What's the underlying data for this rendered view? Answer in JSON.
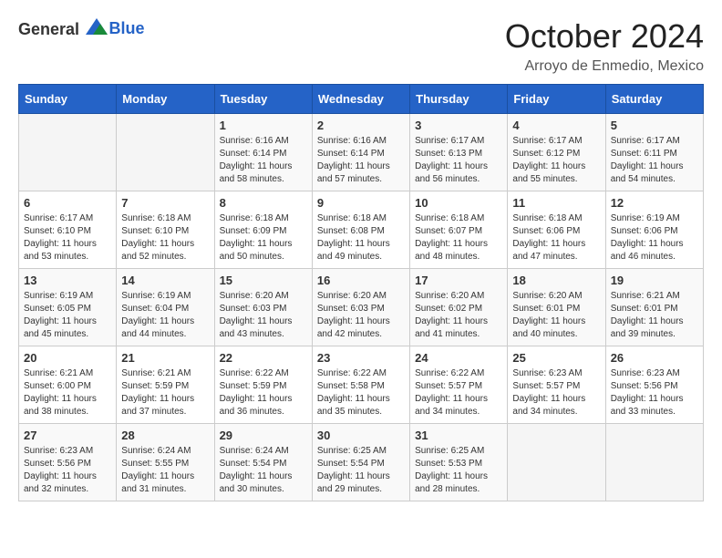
{
  "header": {
    "logo": {
      "general": "General",
      "blue": "Blue"
    },
    "title": "October 2024",
    "location": "Arroyo de Enmedio, Mexico"
  },
  "weekdays": [
    "Sunday",
    "Monday",
    "Tuesday",
    "Wednesday",
    "Thursday",
    "Friday",
    "Saturday"
  ],
  "weeks": [
    [
      {
        "day": "",
        "sunrise": "",
        "sunset": "",
        "daylight": ""
      },
      {
        "day": "",
        "sunrise": "",
        "sunset": "",
        "daylight": ""
      },
      {
        "day": "1",
        "sunrise": "Sunrise: 6:16 AM",
        "sunset": "Sunset: 6:14 PM",
        "daylight": "Daylight: 11 hours and 58 minutes."
      },
      {
        "day": "2",
        "sunrise": "Sunrise: 6:16 AM",
        "sunset": "Sunset: 6:14 PM",
        "daylight": "Daylight: 11 hours and 57 minutes."
      },
      {
        "day": "3",
        "sunrise": "Sunrise: 6:17 AM",
        "sunset": "Sunset: 6:13 PM",
        "daylight": "Daylight: 11 hours and 56 minutes."
      },
      {
        "day": "4",
        "sunrise": "Sunrise: 6:17 AM",
        "sunset": "Sunset: 6:12 PM",
        "daylight": "Daylight: 11 hours and 55 minutes."
      },
      {
        "day": "5",
        "sunrise": "Sunrise: 6:17 AM",
        "sunset": "Sunset: 6:11 PM",
        "daylight": "Daylight: 11 hours and 54 minutes."
      }
    ],
    [
      {
        "day": "6",
        "sunrise": "Sunrise: 6:17 AM",
        "sunset": "Sunset: 6:10 PM",
        "daylight": "Daylight: 11 hours and 53 minutes."
      },
      {
        "day": "7",
        "sunrise": "Sunrise: 6:18 AM",
        "sunset": "Sunset: 6:10 PM",
        "daylight": "Daylight: 11 hours and 52 minutes."
      },
      {
        "day": "8",
        "sunrise": "Sunrise: 6:18 AM",
        "sunset": "Sunset: 6:09 PM",
        "daylight": "Daylight: 11 hours and 50 minutes."
      },
      {
        "day": "9",
        "sunrise": "Sunrise: 6:18 AM",
        "sunset": "Sunset: 6:08 PM",
        "daylight": "Daylight: 11 hours and 49 minutes."
      },
      {
        "day": "10",
        "sunrise": "Sunrise: 6:18 AM",
        "sunset": "Sunset: 6:07 PM",
        "daylight": "Daylight: 11 hours and 48 minutes."
      },
      {
        "day": "11",
        "sunrise": "Sunrise: 6:18 AM",
        "sunset": "Sunset: 6:06 PM",
        "daylight": "Daylight: 11 hours and 47 minutes."
      },
      {
        "day": "12",
        "sunrise": "Sunrise: 6:19 AM",
        "sunset": "Sunset: 6:06 PM",
        "daylight": "Daylight: 11 hours and 46 minutes."
      }
    ],
    [
      {
        "day": "13",
        "sunrise": "Sunrise: 6:19 AM",
        "sunset": "Sunset: 6:05 PM",
        "daylight": "Daylight: 11 hours and 45 minutes."
      },
      {
        "day": "14",
        "sunrise": "Sunrise: 6:19 AM",
        "sunset": "Sunset: 6:04 PM",
        "daylight": "Daylight: 11 hours and 44 minutes."
      },
      {
        "day": "15",
        "sunrise": "Sunrise: 6:20 AM",
        "sunset": "Sunset: 6:03 PM",
        "daylight": "Daylight: 11 hours and 43 minutes."
      },
      {
        "day": "16",
        "sunrise": "Sunrise: 6:20 AM",
        "sunset": "Sunset: 6:03 PM",
        "daylight": "Daylight: 11 hours and 42 minutes."
      },
      {
        "day": "17",
        "sunrise": "Sunrise: 6:20 AM",
        "sunset": "Sunset: 6:02 PM",
        "daylight": "Daylight: 11 hours and 41 minutes."
      },
      {
        "day": "18",
        "sunrise": "Sunrise: 6:20 AM",
        "sunset": "Sunset: 6:01 PM",
        "daylight": "Daylight: 11 hours and 40 minutes."
      },
      {
        "day": "19",
        "sunrise": "Sunrise: 6:21 AM",
        "sunset": "Sunset: 6:01 PM",
        "daylight": "Daylight: 11 hours and 39 minutes."
      }
    ],
    [
      {
        "day": "20",
        "sunrise": "Sunrise: 6:21 AM",
        "sunset": "Sunset: 6:00 PM",
        "daylight": "Daylight: 11 hours and 38 minutes."
      },
      {
        "day": "21",
        "sunrise": "Sunrise: 6:21 AM",
        "sunset": "Sunset: 5:59 PM",
        "daylight": "Daylight: 11 hours and 37 minutes."
      },
      {
        "day": "22",
        "sunrise": "Sunrise: 6:22 AM",
        "sunset": "Sunset: 5:59 PM",
        "daylight": "Daylight: 11 hours and 36 minutes."
      },
      {
        "day": "23",
        "sunrise": "Sunrise: 6:22 AM",
        "sunset": "Sunset: 5:58 PM",
        "daylight": "Daylight: 11 hours and 35 minutes."
      },
      {
        "day": "24",
        "sunrise": "Sunrise: 6:22 AM",
        "sunset": "Sunset: 5:57 PM",
        "daylight": "Daylight: 11 hours and 34 minutes."
      },
      {
        "day": "25",
        "sunrise": "Sunrise: 6:23 AM",
        "sunset": "Sunset: 5:57 PM",
        "daylight": "Daylight: 11 hours and 34 minutes."
      },
      {
        "day": "26",
        "sunrise": "Sunrise: 6:23 AM",
        "sunset": "Sunset: 5:56 PM",
        "daylight": "Daylight: 11 hours and 33 minutes."
      }
    ],
    [
      {
        "day": "27",
        "sunrise": "Sunrise: 6:23 AM",
        "sunset": "Sunset: 5:56 PM",
        "daylight": "Daylight: 11 hours and 32 minutes."
      },
      {
        "day": "28",
        "sunrise": "Sunrise: 6:24 AM",
        "sunset": "Sunset: 5:55 PM",
        "daylight": "Daylight: 11 hours and 31 minutes."
      },
      {
        "day": "29",
        "sunrise": "Sunrise: 6:24 AM",
        "sunset": "Sunset: 5:54 PM",
        "daylight": "Daylight: 11 hours and 30 minutes."
      },
      {
        "day": "30",
        "sunrise": "Sunrise: 6:25 AM",
        "sunset": "Sunset: 5:54 PM",
        "daylight": "Daylight: 11 hours and 29 minutes."
      },
      {
        "day": "31",
        "sunrise": "Sunrise: 6:25 AM",
        "sunset": "Sunset: 5:53 PM",
        "daylight": "Daylight: 11 hours and 28 minutes."
      },
      {
        "day": "",
        "sunrise": "",
        "sunset": "",
        "daylight": ""
      },
      {
        "day": "",
        "sunrise": "",
        "sunset": "",
        "daylight": ""
      }
    ]
  ]
}
